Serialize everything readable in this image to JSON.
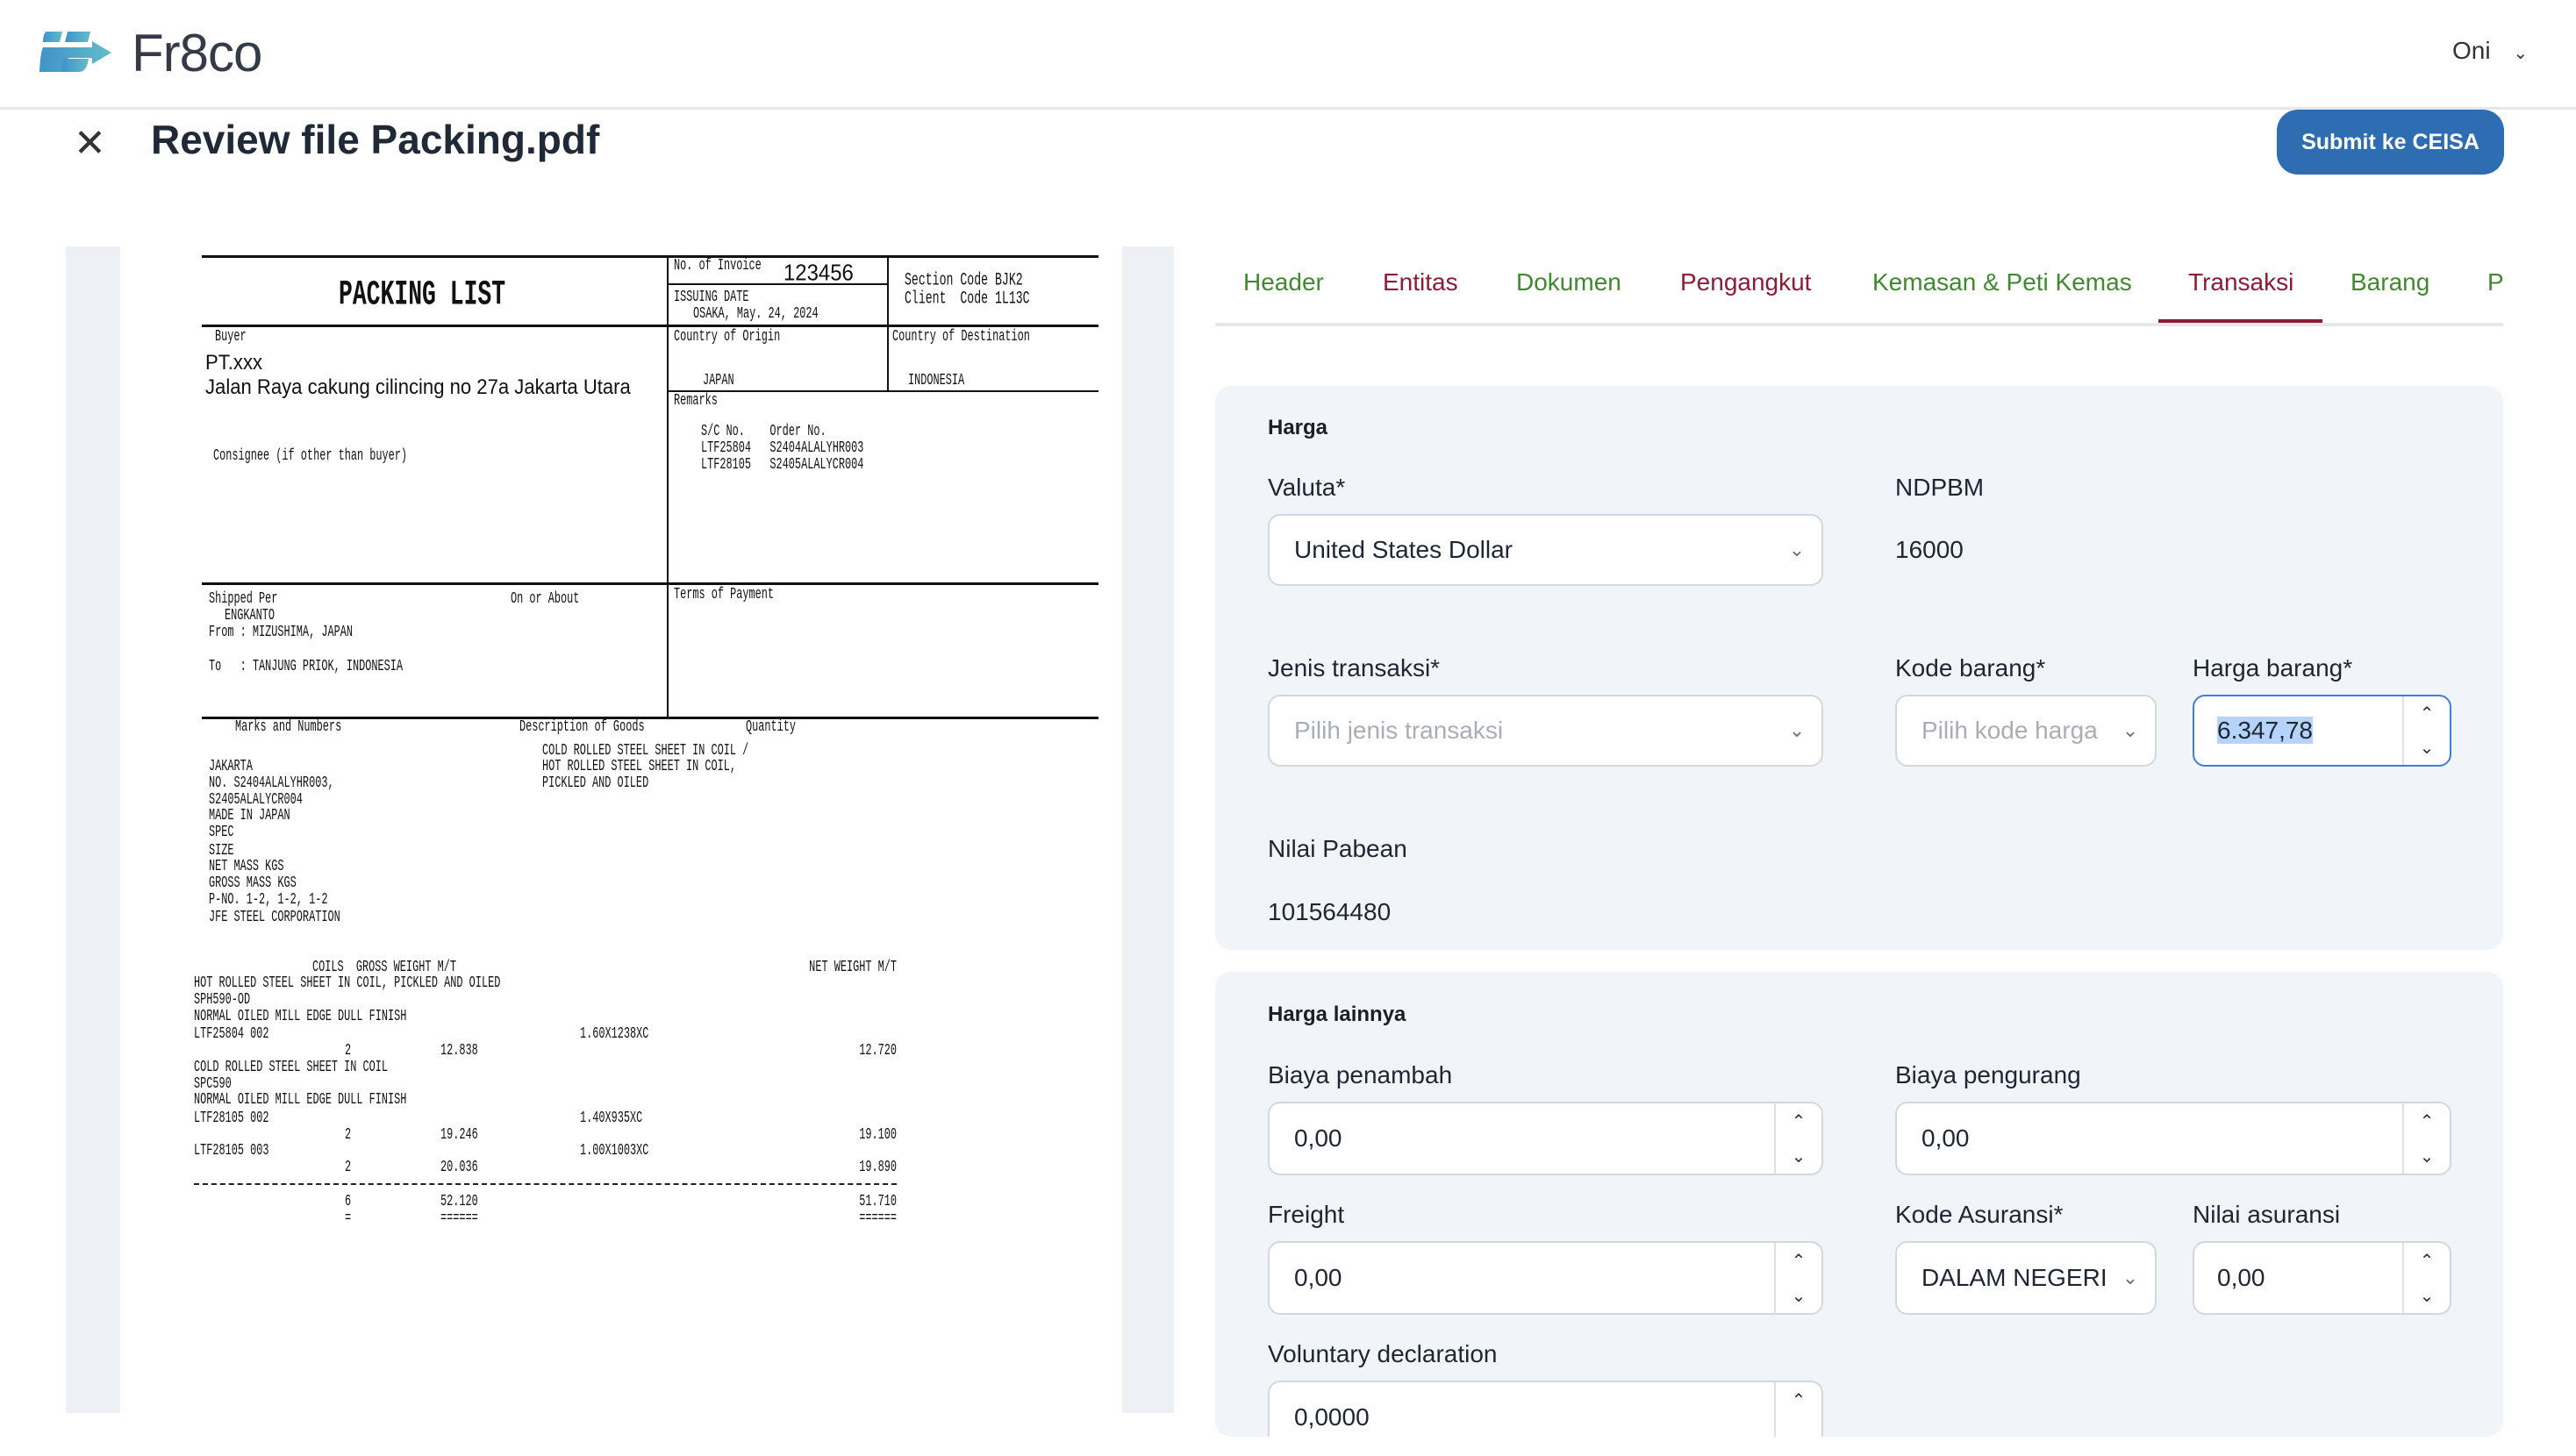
{
  "app": {
    "brand": "Fr8co",
    "user": "Oni"
  },
  "page": {
    "title": "Review file Packing.pdf",
    "submit_label": "Submit ke CEISA"
  },
  "document": {
    "title": "PACKING LIST",
    "invoice_label": "No. of Invoice",
    "invoice_no": "123456",
    "issuing_label": "ISSUING DATE",
    "issuing_date": "OSAKA, May. 24, 2024",
    "section_code": "Section Code BJK2",
    "client_code": "Client  Code 1L13C",
    "buyer_label": "Buyer",
    "buyer_name": "PT.xxx",
    "buyer_address": "Jalan Raya cakung cilincing no 27a Jakarta Utara",
    "origin_label": "Country of Origin",
    "origin": "JAPAN",
    "destination_label": "Country of Destination",
    "destination": "INDONESIA",
    "remarks_label": "Remarks",
    "remarks_header": "S/C No.    Order No.",
    "remarks_rows": [
      "LTF25804   S2404ALALYHR003",
      "LTF28105   S2405ALALYCR004"
    ],
    "consignee_label": "Consignee (if other than buyer)",
    "shipped_per_label": "Shipped Per",
    "vessel": "ENGKANTO",
    "from": "From : MIZUSHIMA, JAPAN",
    "to": "To   : TANJUNG PRIOK, INDONESIA",
    "on_about_label": "On or About",
    "terms_label": "Terms of Payment",
    "marks_label": "Marks and Numbers",
    "desc_label": "Description of Goods",
    "qty_label": "Quantity",
    "desc_lines": [
      "COLD ROLLED STEEL SHEET IN COIL /",
      "HOT ROLLED STEEL SHEET IN COIL,",
      "PICKLED AND OILED"
    ],
    "marks_lines": [
      "JAKARTA",
      "NO. S2404ALALYHR003,",
      "S2405ALALYCR004",
      "MADE IN JAPAN",
      "SPEC",
      "SIZE",
      "NET MASS KGS",
      "GROSS MASS KGS",
      "P-NO. 1-2, 1-2, 1-2",
      "JFE STEEL CORPORATION"
    ],
    "table_header_left": "COILS  GROSS WEIGHT M/T",
    "table_header_right": "NET WEIGHT M/T",
    "items": [
      {
        "lines": [
          "HOT ROLLED STEEL SHEET IN COIL, PICKLED AND OILED",
          "SPH590-OD",
          "NORMAL OILED MILL EDGE DULL FINISH"
        ],
        "lot": "LTF25804 002",
        "size": "1.60X1238XC",
        "coils": "2",
        "gross": "12.838",
        "net": "12.720"
      },
      {
        "lines": [
          "COLD ROLLED STEEL SHEET IN COIL",
          "SPC590",
          "NORMAL OILED MILL EDGE DULL FINISH"
        ],
        "lot": "LTF28105 002",
        "size": "1.40X935XC",
        "coils": "2",
        "gross": "19.246",
        "net": "19.100"
      },
      {
        "lot": "LTF28105 003",
        "size": "1.00X1003XC",
        "coils": "2",
        "gross": "20.036",
        "net": "19.890"
      }
    ],
    "total": {
      "coils": "6",
      "gross": "52.120",
      "net": "51.710",
      "coils_rule": "=",
      "gross_rule": "======",
      "net_rule": "======"
    }
  },
  "tabs": [
    {
      "label": "Header",
      "color": "#3f8a2f"
    },
    {
      "label": "Entitas",
      "color": "#8e1b35"
    },
    {
      "label": "Dokumen",
      "color": "#3f8a2f"
    },
    {
      "label": "Pengangkut",
      "color": "#8e1b35"
    },
    {
      "label": "Kemasan & Peti Kemas",
      "color": "#3f8a2f"
    },
    {
      "label": "Transaksi",
      "color": "#8e1b35",
      "active": true
    },
    {
      "label": "Barang",
      "color": "#3f8a2f"
    },
    {
      "label": "Pungutan",
      "color": "#3f8a2f"
    }
  ],
  "harga": {
    "title": "Harga",
    "valuta_label": "Valuta*",
    "valuta_value": "United States Dollar",
    "ndpbm_label": "NDPBM",
    "ndpbm_value": "16000",
    "jenis_label": "Jenis transaksi*",
    "jenis_placeholder": "Pilih jenis transaksi",
    "kode_label": "Kode barang*",
    "kode_placeholder": "Pilih kode harga",
    "harga_label": "Harga barang*",
    "harga_value": "6.347,78",
    "nilai_pabean_label": "Nilai Pabean",
    "nilai_pabean_value": "101564480"
  },
  "harga_lainnya": {
    "title": "Harga lainnya",
    "biaya_penambah_label": "Biaya penambah",
    "biaya_penambah_value": "0,00",
    "biaya_pengurang_label": "Biaya pengurang",
    "biaya_pengurang_value": "0,00",
    "freight_label": "Freight",
    "freight_value": "0,00",
    "kode_asuransi_label": "Kode Asuransi*",
    "kode_asuransi_value": "DALAM NEGERI",
    "nilai_asuransi_label": "Nilai asuransi",
    "nilai_asuransi_value": "0,00",
    "voluntary_label": "Voluntary declaration",
    "voluntary_value": "0,0000"
  },
  "colors": {
    "brand": "#4a9fcf",
    "primary": "#2f6db3",
    "tab_green": "#3f8a2f",
    "tab_red": "#8e1b35",
    "card_bg": "#f1f4f9"
  }
}
